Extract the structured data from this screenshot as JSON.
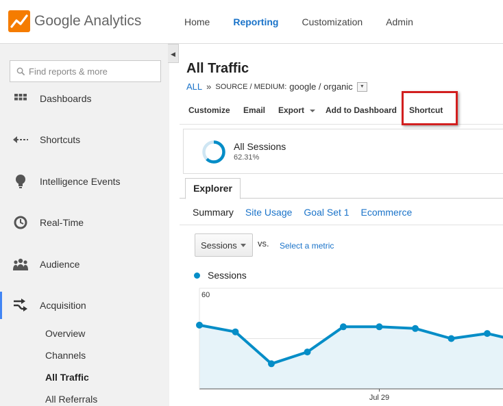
{
  "app": {
    "name": "Google Analytics",
    "brand_colors": {
      "orange": "#f57c00",
      "link_blue": "#1a73c9",
      "series_blue": "#058dc7",
      "highlight_red": "#d21f1f"
    }
  },
  "topnav": {
    "items": [
      {
        "label": "Home",
        "active": false
      },
      {
        "label": "Reporting",
        "active": true
      },
      {
        "label": "Customization",
        "active": false
      },
      {
        "label": "Admin",
        "active": false
      }
    ]
  },
  "sidebar": {
    "search_placeholder": "Find reports & more",
    "items": [
      {
        "label": "Dashboards",
        "icon": "grid-icon"
      },
      {
        "label": "Shortcuts",
        "icon": "shortcut-arrow-icon"
      },
      {
        "label": "Intelligence Events",
        "icon": "lightbulb-icon"
      },
      {
        "label": "Real-Time",
        "icon": "clock-icon"
      },
      {
        "label": "Audience",
        "icon": "people-icon"
      },
      {
        "label": "Acquisition",
        "icon": "acquisition-arrows-icon",
        "selected": true
      }
    ],
    "sub_items": [
      {
        "label": "Overview"
      },
      {
        "label": "Channels"
      },
      {
        "label": "All Traffic",
        "current": true
      },
      {
        "label": "All Referrals"
      }
    ]
  },
  "report": {
    "title": "All Traffic",
    "breadcrumb": {
      "all": "ALL",
      "separator": "»",
      "dimension": "SOURCE / MEDIUM:",
      "value": "google / organic"
    },
    "actions": [
      "Customize",
      "Email",
      "Export",
      "Add to Dashboard",
      "Shortcut"
    ],
    "segment": {
      "name": "All Sessions",
      "percent": "62.31%",
      "fraction": 0.6231
    },
    "tab": "Explorer",
    "subtabs": [
      "Summary",
      "Site Usage",
      "Goal Set 1",
      "Ecommerce"
    ],
    "metric": {
      "selected": "Sessions",
      "vs": "vs.",
      "select_link": "Select a metric"
    },
    "legend": "Sessions"
  },
  "chart_data": {
    "type": "area",
    "series": [
      {
        "name": "Sessions",
        "values": [
          38,
          34,
          15,
          22,
          37,
          37,
          36,
          30,
          33,
          28
        ]
      }
    ],
    "ylim": [
      0,
      60
    ],
    "yticks": [
      30,
      60
    ],
    "x_tick_label": "Jul 29",
    "x_tick_index": 5,
    "grid": true
  }
}
